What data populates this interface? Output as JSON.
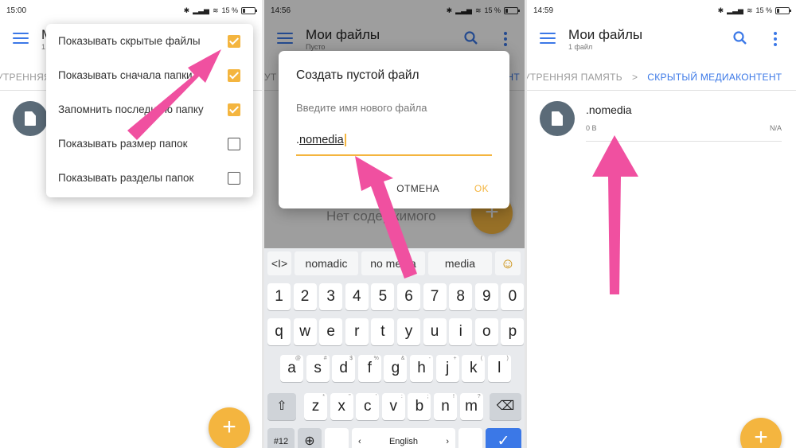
{
  "colors": {
    "accent": "#3b78e7",
    "fab": "#f4b53f",
    "arrow": "#f050a0",
    "checkbox_on": "#f4b53f"
  },
  "panel1": {
    "time": "15:00",
    "battery": "15 %",
    "toolbar": {
      "title": "М",
      "subtitle": "1"
    },
    "crumb": "УТРЕННЯЯ ПА",
    "menu": {
      "items": [
        {
          "label": "Показывать скрытые файлы",
          "checked": true
        },
        {
          "label": "Показывать сначала папки",
          "checked": true
        },
        {
          "label": "Запомнить последнюю папку",
          "checked": true
        },
        {
          "label": "Показывать размер папок",
          "checked": false
        },
        {
          "label": "Показывать разделы папок",
          "checked": false
        }
      ]
    },
    "fab": "+"
  },
  "panel2": {
    "time": "14:56",
    "battery": "15 %",
    "toolbar": {
      "title": "Мои файлы",
      "subtitle": "Пусто"
    },
    "crumb_left": "УТ",
    "crumb_right": "НТ",
    "empty_text": "Нет содержимого",
    "dialog": {
      "title": "Создать пустой файл",
      "hint": "Введите имя нового файла",
      "value_prefix": ".",
      "value": "nomedia",
      "cancel": "ОТМЕНА",
      "ok": "OK"
    },
    "keyboard": {
      "suggestions": [
        "nomadic",
        "no media",
        "media"
      ],
      "cursor_key": "<I>",
      "emoji": "☺",
      "row_numbers": [
        "1",
        "2",
        "3",
        "4",
        "5",
        "6",
        "7",
        "8",
        "9",
        "0"
      ],
      "row_q": [
        "q",
        "w",
        "e",
        "r",
        "t",
        "y",
        "u",
        "i",
        "o",
        "p"
      ],
      "row_a": [
        {
          "k": "a",
          "s": "@"
        },
        {
          "k": "s",
          "s": "#"
        },
        {
          "k": "d",
          "s": "$"
        },
        {
          "k": "f",
          "s": "%"
        },
        {
          "k": "g",
          "s": "&"
        },
        {
          "k": "h",
          "s": "-"
        },
        {
          "k": "j",
          "s": "+"
        },
        {
          "k": "k",
          "s": "("
        },
        {
          "k": "l",
          "s": ")"
        }
      ],
      "row_z": [
        {
          "k": "z",
          "s": "*"
        },
        {
          "k": "x",
          "s": "\""
        },
        {
          "k": "c",
          "s": "'"
        },
        {
          "k": "v",
          "s": ":"
        },
        {
          "k": "b",
          "s": ";"
        },
        {
          "k": "n",
          "s": "!"
        },
        {
          "k": "m",
          "s": "?"
        }
      ],
      "shift": "⇧",
      "backspace": "⌫",
      "symbols": "#12",
      "globe": "⊕",
      "space": "English",
      "arrow_left": "‹",
      "arrow_right": "›",
      "enter": "✓"
    }
  },
  "panel3": {
    "time": "14:59",
    "battery": "15 %",
    "toolbar": {
      "title": "Мои файлы",
      "subtitle": "1 файл"
    },
    "crumbs": {
      "first": "УТРЕННЯЯ ПАМЯТЬ",
      "separator": ">",
      "current": "СКРЫТЫЙ МЕДИАКОНТЕНТ"
    },
    "file": {
      "name": ".nomedia",
      "size": "0 B",
      "date": "N/A"
    },
    "fab": "+"
  }
}
